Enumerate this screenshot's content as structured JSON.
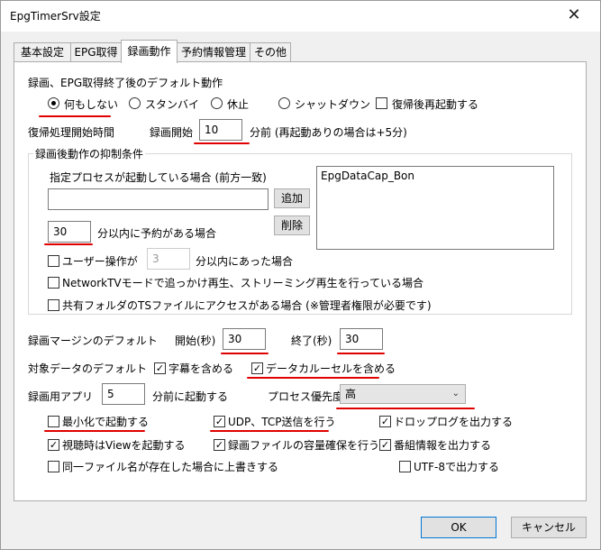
{
  "window": {
    "title": "EpgTimerSrv設定",
    "close_glyph": "✕"
  },
  "tabs": [
    {
      "label": "基本設定"
    },
    {
      "label": "EPG取得"
    },
    {
      "label": "録画動作"
    },
    {
      "label": "予約情報管理"
    },
    {
      "label": "その他"
    }
  ],
  "default_action": {
    "heading": "録画、EPG取得終了後のデフォルト動作",
    "options": [
      "何もしない",
      "スタンバイ",
      "休止",
      "シャットダウン"
    ],
    "selected": "何もしない",
    "reboot_label": "復帰後再起動する"
  },
  "resume": {
    "label": "復帰処理開始時間",
    "record_start_label": "録画開始",
    "minutes": "10",
    "suffix": "分前 (再起動ありの場合は+5分)"
  },
  "suppress": {
    "group_title": "録画後動作の抑制条件",
    "process_label": "指定プロセスが起動している場合 (前方一致)",
    "process_input": "",
    "add_button": "追加",
    "delete_button": "削除",
    "process_list": [
      "EpgDataCap_Bon"
    ],
    "reserve_minutes": "30",
    "reserve_suffix": "分以内に予約がある場合",
    "user_op_label": "ユーザー操作が",
    "user_op_minutes": "3",
    "user_op_suffix": "分以内にあった場合",
    "network_tv_label": "NetworkTVモードで追っかけ再生、ストリーミング再生を行っている場合",
    "shared_folder_label": "共有フォルダのTSファイルにアクセスがある場合 (※管理者権限が必要です)"
  },
  "margin": {
    "label": "録画マージンのデフォルト",
    "start_label": "開始(秒)",
    "start_value": "30",
    "end_label": "終了(秒)",
    "end_value": "30"
  },
  "target_data": {
    "label": "対象データのデフォルト",
    "subtitle_label": "字幕を含める",
    "carousel_label": "データカルーセルを含める"
  },
  "app": {
    "label": "録画用アプリ",
    "minutes": "5",
    "suffix": "分前に起動する",
    "priority_label": "プロセス優先度",
    "priority_value": "高"
  },
  "options": {
    "minimize": "最小化で起動する",
    "udp_tcp": "UDP、TCP送信を行う",
    "drop_log": "ドロップログを出力する",
    "view_launch": "視聴時はViewを起動する",
    "reserve_capacity": "録画ファイルの容量確保を行う",
    "program_info": "番組情報を出力する",
    "overwrite": "同一ファイル名が存在した場合に上書きする",
    "utf8": "UTF-8で出力する"
  },
  "checked_glyph": "✓",
  "buttons": {
    "ok": "OK",
    "cancel": "キャンセル"
  },
  "colors": {
    "annotation": "#e00000",
    "ok_border": "#0078d7"
  }
}
